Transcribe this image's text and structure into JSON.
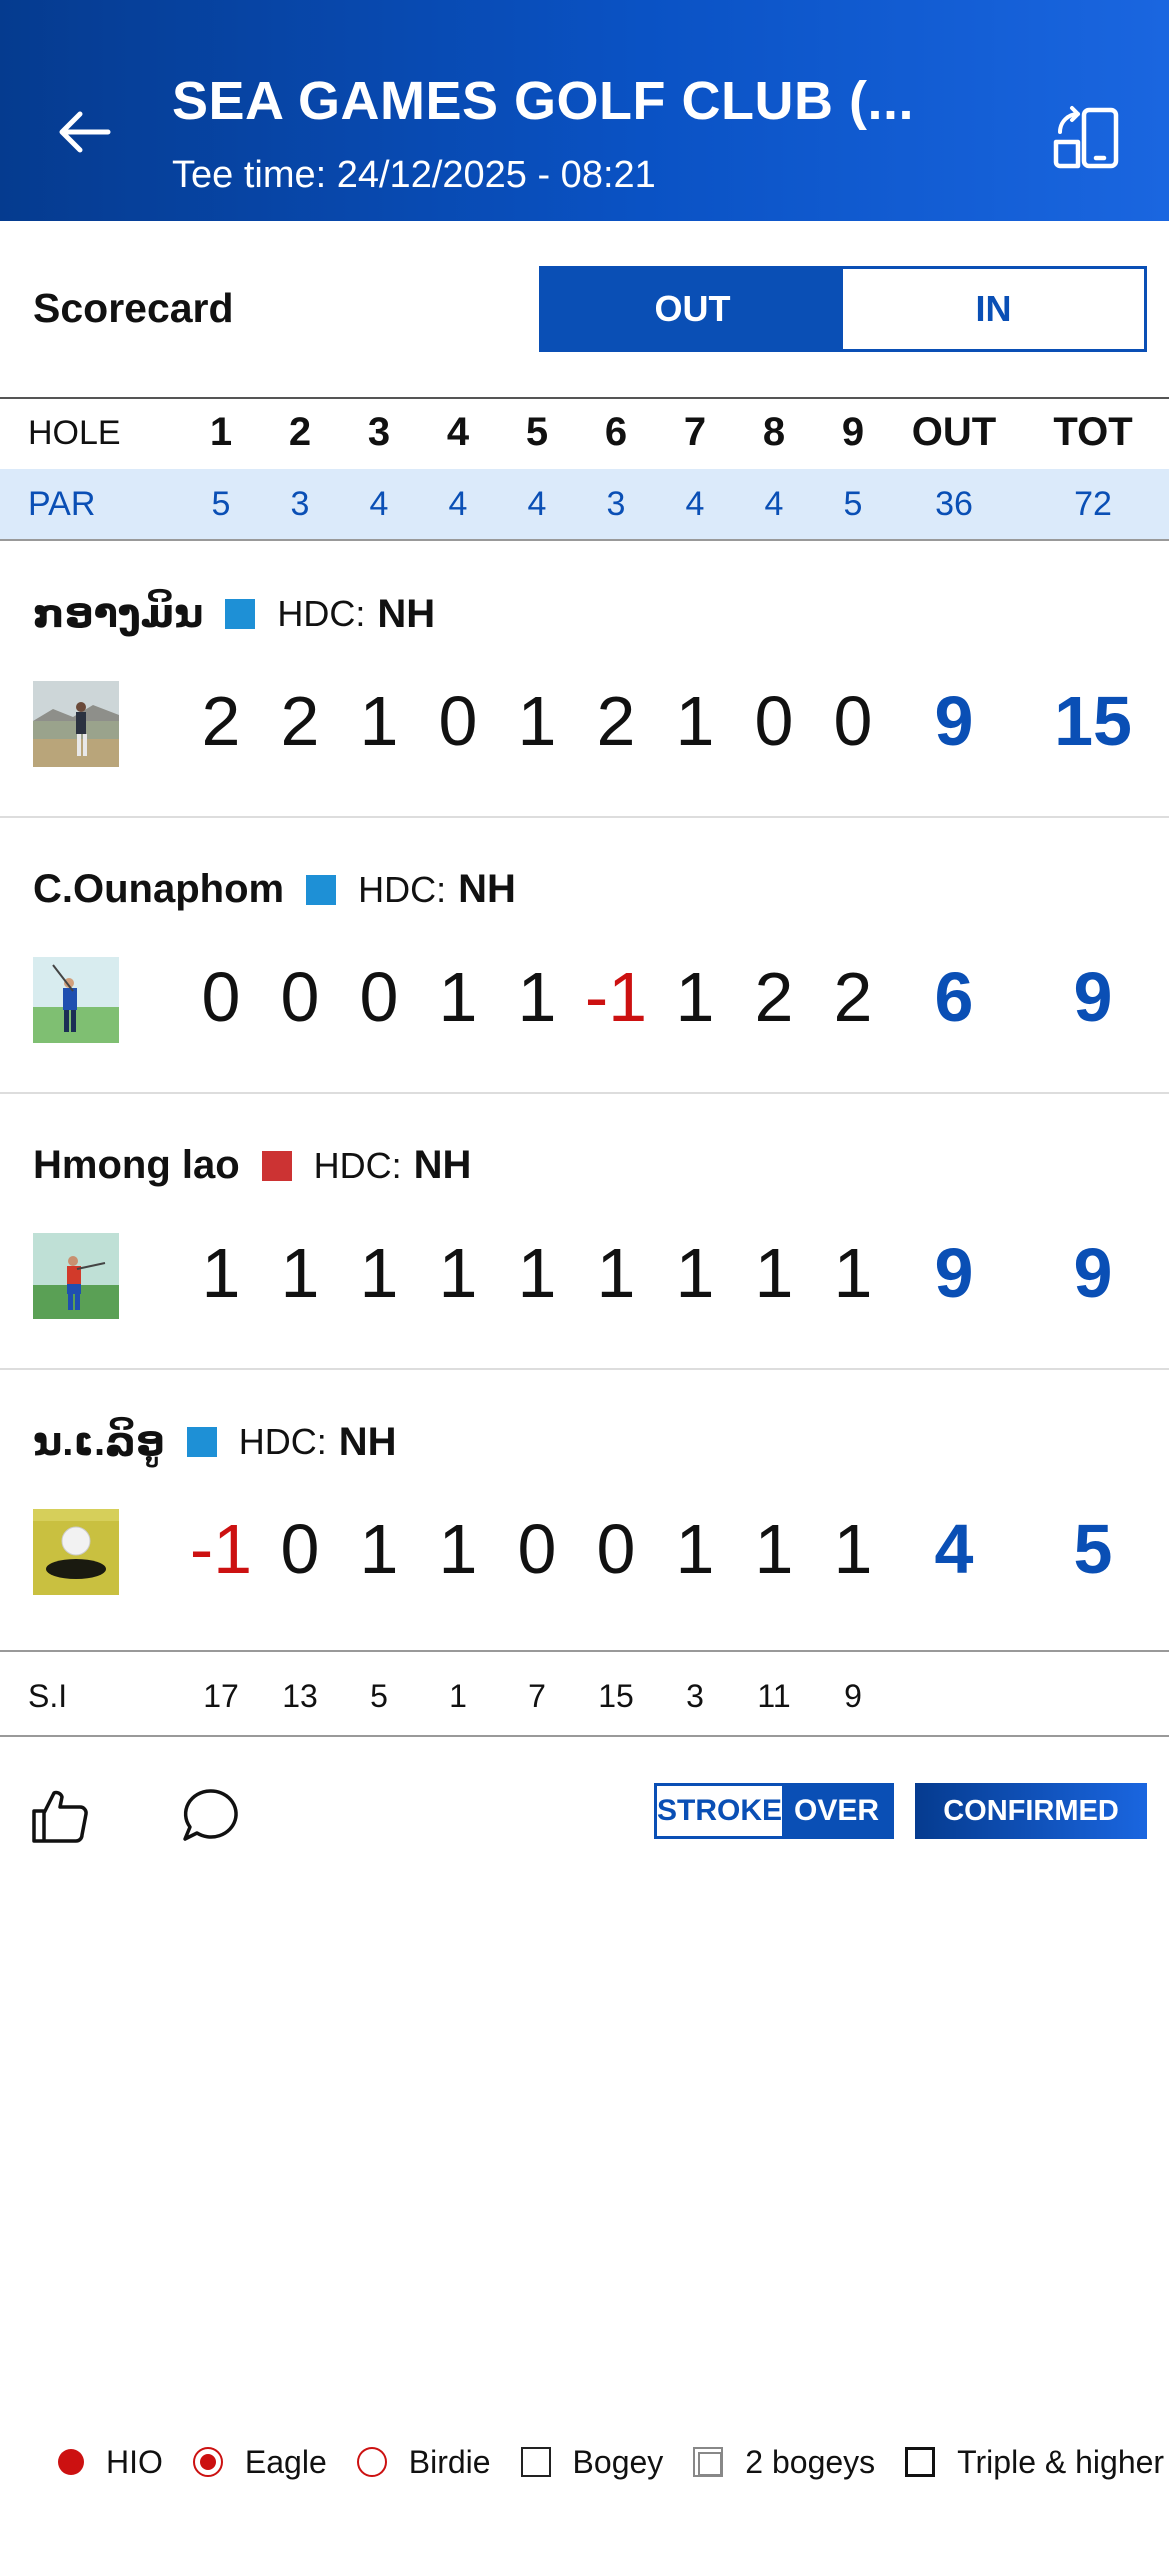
{
  "header": {
    "title": "SEA GAMES GOLF CLUB (...",
    "tee_time": "Tee time: 24/12/2025 - 08:21"
  },
  "scorecard": {
    "label": "Scorecard",
    "tab_out": "OUT",
    "tab_in": "IN",
    "active_tab": "OUT"
  },
  "table": {
    "hole_label": "HOLE",
    "holes": [
      "1",
      "2",
      "3",
      "4",
      "5",
      "6",
      "7",
      "8",
      "9"
    ],
    "out_label": "OUT",
    "tot_label": "TOT",
    "par_label": "PAR",
    "par": [
      "5",
      "3",
      "4",
      "4",
      "4",
      "3",
      "4",
      "4",
      "5"
    ],
    "par_out": "36",
    "par_tot": "72",
    "si_label": "S.I",
    "si": [
      "17",
      "13",
      "5",
      "1",
      "7",
      "15",
      "3",
      "11",
      "9"
    ]
  },
  "players": [
    {
      "name": "ກອາງມິນ",
      "color": "#1e90d6",
      "hdc_label": "HDC:",
      "hdc": "NH",
      "scores": [
        "2",
        "2",
        "1",
        "0",
        "1",
        "2",
        "1",
        "0",
        "0"
      ],
      "out": "9",
      "tot": "15"
    },
    {
      "name": "C.Ounaphom",
      "color": "#1e90d6",
      "hdc_label": "HDC:",
      "hdc": "NH",
      "scores": [
        "0",
        "0",
        "0",
        "1",
        "1",
        "-1",
        "1",
        "2",
        "2"
      ],
      "out": "6",
      "tot": "9"
    },
    {
      "name": "Hmong lao",
      "color": "#cc3333",
      "hdc_label": "HDC:",
      "hdc": "NH",
      "scores": [
        "1",
        "1",
        "1",
        "1",
        "1",
        "1",
        "1",
        "1",
        "1"
      ],
      "out": "9",
      "tot": "9"
    },
    {
      "name": "ນ.ເ.ລິອູ",
      "color": "#1e90d6",
      "hdc_label": "HDC:",
      "hdc": "NH",
      "scores": [
        "-1",
        "0",
        "1",
        "1",
        "0",
        "0",
        "1",
        "1",
        "1"
      ],
      "out": "4",
      "tot": "5"
    }
  ],
  "actions": {
    "mode_stroke": "STROKE",
    "mode_over": "OVER",
    "status": "CONFIRMED"
  },
  "legend": [
    {
      "label": "HIO",
      "icon": "hio"
    },
    {
      "label": "Eagle",
      "icon": "eagle"
    },
    {
      "label": "Birdie",
      "icon": "birdie"
    },
    {
      "label": "Bogey",
      "icon": "bogey"
    },
    {
      "label": "2 bogeys",
      "icon": "2bogeys"
    },
    {
      "label": "Triple & higher",
      "icon": "triple"
    }
  ],
  "colors": {
    "brand_blue": "#0a4fb5",
    "under_par_red": "#cc1111",
    "par_row_bg": "#dbeafa"
  }
}
